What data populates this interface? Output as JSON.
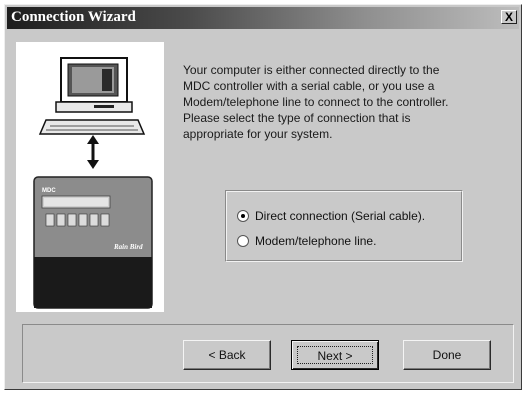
{
  "window": {
    "title": "Connection Wizard",
    "close_label": "X"
  },
  "illustration": {
    "brand_icon": "computer-to-controller-illustration",
    "controller_label": "MDC",
    "controller_brand": "Rain Bird"
  },
  "description": {
    "lines": [
      "Your computer is either connected directly to the",
      "MDC controller with a serial cable, or you use a",
      "Modem/telephone line to connect to the controller.",
      "Please select the type of connection that is",
      "appropriate for your system."
    ]
  },
  "connection": {
    "options": [
      {
        "label": "Direct connection (Serial cable).",
        "selected": true
      },
      {
        "label": "Modem/telephone line.",
        "selected": false
      }
    ]
  },
  "buttons": {
    "back": "< Back",
    "next": "Next >",
    "done": "Done"
  }
}
